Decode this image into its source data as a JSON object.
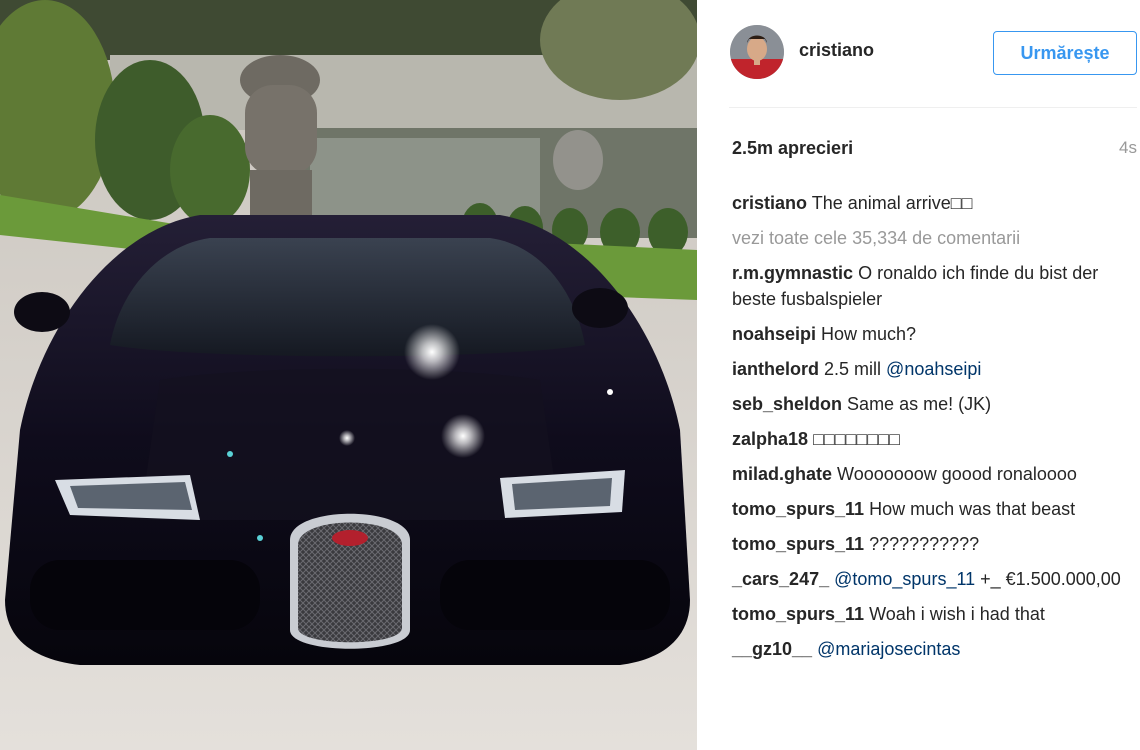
{
  "post": {
    "username": "cristiano",
    "follow_label": "Urmărește",
    "likes": "2.5m aprecieri",
    "time": "4s",
    "view_all": "vezi toate cele 35,334 de comentarii",
    "caption": {
      "user": "cristiano",
      "text": "The animal arrive□□"
    },
    "comments": [
      {
        "user": "r.m.gymnastic",
        "mention": "",
        "text": "O ronaldo ich finde du bist der beste fusbalspieler"
      },
      {
        "user": "noahseipi",
        "mention": "",
        "text": "How much?"
      },
      {
        "user": "ianthelord",
        "mention": "",
        "text": "2.5 mill @noahseipi"
      },
      {
        "user": "seb_sheldon",
        "mention": "",
        "text": "Same as me! (JK)"
      },
      {
        "user": "zalpha18",
        "mention": "",
        "text": "□□□□□□□□"
      },
      {
        "user": "milad.ghate",
        "mention": "",
        "text": "Wooooooow goood ronaloooo"
      },
      {
        "user": "tomo_spurs_11",
        "mention": "",
        "text": "How much was that beast"
      },
      {
        "user": "tomo_spurs_11",
        "mention": "",
        "text": "???????????"
      },
      {
        "user": "_cars_247_",
        "mention": "",
        "text": "@tomo_spurs_11 +_ €1.500.000,00"
      },
      {
        "user": "tomo_spurs_11",
        "mention": "",
        "text": "Woah i wish i had that"
      },
      {
        "user": "__gz10__",
        "mention": "",
        "text": "@mariajosecintas"
      }
    ]
  },
  "photo": {
    "badge_text": "BUGATTI"
  },
  "colors": {
    "accent": "#3897f0",
    "mention": "#003569",
    "muted": "#999999",
    "car_body": "#0f0c1c"
  }
}
